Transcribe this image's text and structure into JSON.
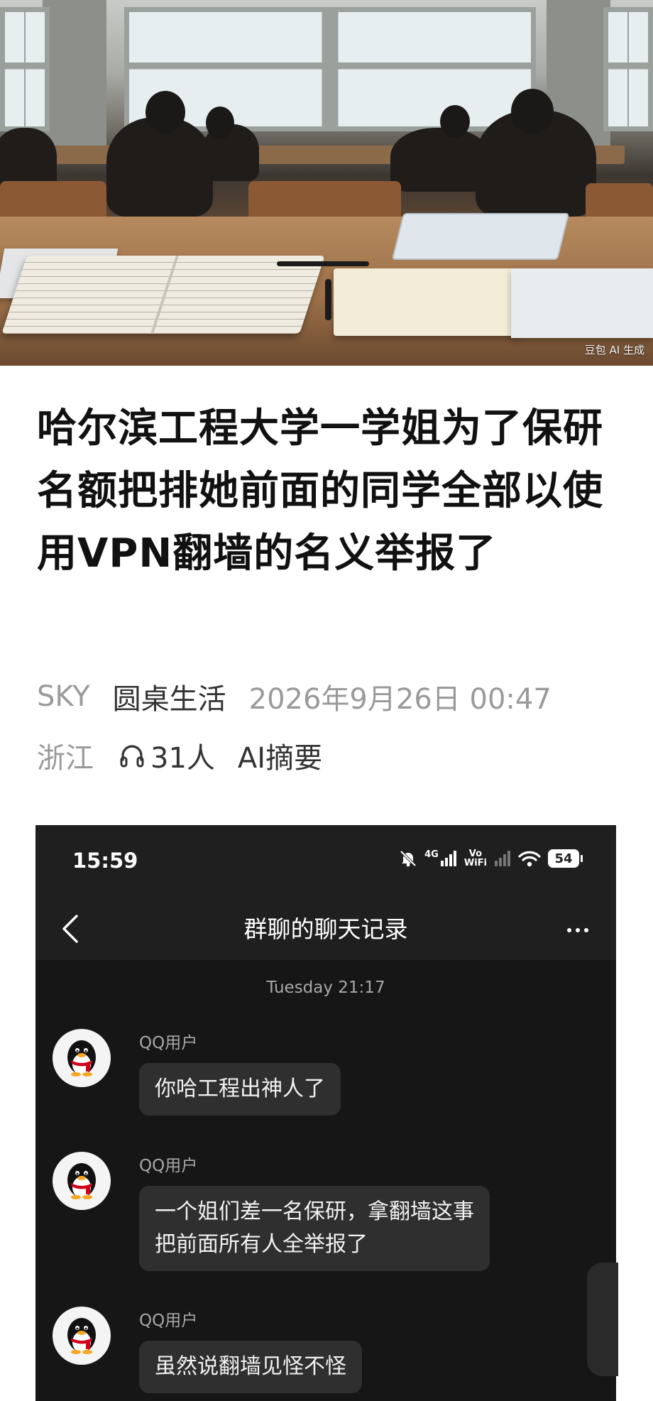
{
  "hero": {
    "watermark": "豆包 AI 生成"
  },
  "article": {
    "title": "哈尔滨工程大学一学姐为了保研名额把排她前面的同学全部以使用VPN翻墙的名义举报了",
    "author": "SKY",
    "channel": "圆桌生活",
    "date": "2026年9月26日 00:47",
    "location": "浙江",
    "listen_count": "31人",
    "ai_summary": "AI摘要"
  },
  "screenshot": {
    "status": {
      "time": "15:59",
      "network": "4G",
      "vowifi_top": "Vo",
      "vowifi_bottom": "WiFi",
      "battery": "54"
    },
    "header": {
      "title": "群聊的聊天记录"
    },
    "date": "Tuesday 21:17",
    "messages": [
      {
        "sender": "QQ用户",
        "text": "你哈工程出神人了"
      },
      {
        "sender": "QQ用户",
        "text": "一个姐们差一名保研，拿翻墙这事\n把前面所有人全举报了"
      },
      {
        "sender": "QQ用户",
        "text": "虽然说翻墙见怪不怪"
      }
    ]
  },
  "icons": {
    "headphones": "headphones-icon",
    "back": "chevron-left-icon",
    "more": "more-icon",
    "mute": "bell-off-icon",
    "signal": "signal-icon",
    "wifi": "wifi-icon",
    "avatar": "penguin-avatar-icon"
  }
}
